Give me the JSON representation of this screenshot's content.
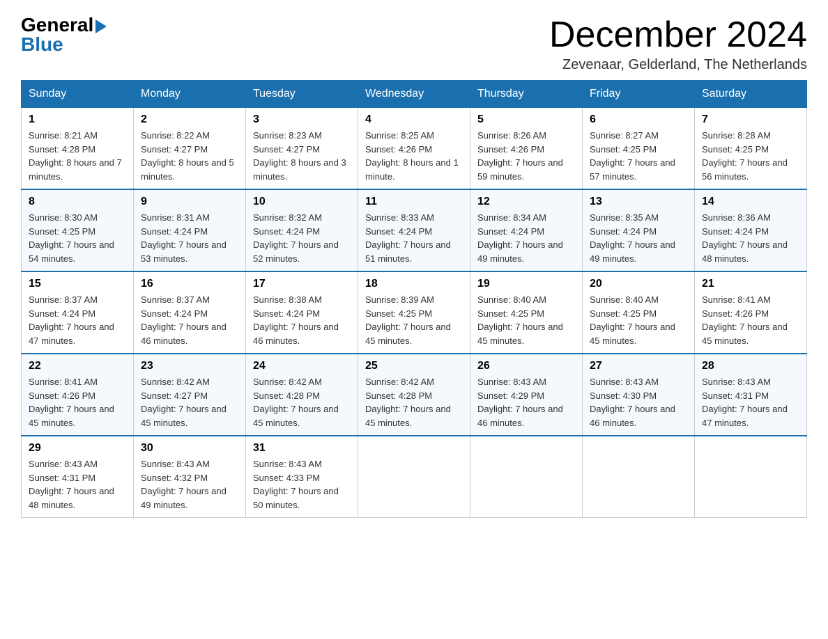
{
  "logo": {
    "general": "General",
    "blue": "Blue",
    "triangle": "▶"
  },
  "title": "December 2024",
  "location": "Zevenaar, Gelderland, The Netherlands",
  "days_of_week": [
    "Sunday",
    "Monday",
    "Tuesday",
    "Wednesday",
    "Thursday",
    "Friday",
    "Saturday"
  ],
  "weeks": [
    [
      {
        "day": "1",
        "sunrise": "8:21 AM",
        "sunset": "4:28 PM",
        "daylight": "8 hours and 7 minutes."
      },
      {
        "day": "2",
        "sunrise": "8:22 AM",
        "sunset": "4:27 PM",
        "daylight": "8 hours and 5 minutes."
      },
      {
        "day": "3",
        "sunrise": "8:23 AM",
        "sunset": "4:27 PM",
        "daylight": "8 hours and 3 minutes."
      },
      {
        "day": "4",
        "sunrise": "8:25 AM",
        "sunset": "4:26 PM",
        "daylight": "8 hours and 1 minute."
      },
      {
        "day": "5",
        "sunrise": "8:26 AM",
        "sunset": "4:26 PM",
        "daylight": "7 hours and 59 minutes."
      },
      {
        "day": "6",
        "sunrise": "8:27 AM",
        "sunset": "4:25 PM",
        "daylight": "7 hours and 57 minutes."
      },
      {
        "day": "7",
        "sunrise": "8:28 AM",
        "sunset": "4:25 PM",
        "daylight": "7 hours and 56 minutes."
      }
    ],
    [
      {
        "day": "8",
        "sunrise": "8:30 AM",
        "sunset": "4:25 PM",
        "daylight": "7 hours and 54 minutes."
      },
      {
        "day": "9",
        "sunrise": "8:31 AM",
        "sunset": "4:24 PM",
        "daylight": "7 hours and 53 minutes."
      },
      {
        "day": "10",
        "sunrise": "8:32 AM",
        "sunset": "4:24 PM",
        "daylight": "7 hours and 52 minutes."
      },
      {
        "day": "11",
        "sunrise": "8:33 AM",
        "sunset": "4:24 PM",
        "daylight": "7 hours and 51 minutes."
      },
      {
        "day": "12",
        "sunrise": "8:34 AM",
        "sunset": "4:24 PM",
        "daylight": "7 hours and 49 minutes."
      },
      {
        "day": "13",
        "sunrise": "8:35 AM",
        "sunset": "4:24 PM",
        "daylight": "7 hours and 49 minutes."
      },
      {
        "day": "14",
        "sunrise": "8:36 AM",
        "sunset": "4:24 PM",
        "daylight": "7 hours and 48 minutes."
      }
    ],
    [
      {
        "day": "15",
        "sunrise": "8:37 AM",
        "sunset": "4:24 PM",
        "daylight": "7 hours and 47 minutes."
      },
      {
        "day": "16",
        "sunrise": "8:37 AM",
        "sunset": "4:24 PM",
        "daylight": "7 hours and 46 minutes."
      },
      {
        "day": "17",
        "sunrise": "8:38 AM",
        "sunset": "4:24 PM",
        "daylight": "7 hours and 46 minutes."
      },
      {
        "day": "18",
        "sunrise": "8:39 AM",
        "sunset": "4:25 PM",
        "daylight": "7 hours and 45 minutes."
      },
      {
        "day": "19",
        "sunrise": "8:40 AM",
        "sunset": "4:25 PM",
        "daylight": "7 hours and 45 minutes."
      },
      {
        "day": "20",
        "sunrise": "8:40 AM",
        "sunset": "4:25 PM",
        "daylight": "7 hours and 45 minutes."
      },
      {
        "day": "21",
        "sunrise": "8:41 AM",
        "sunset": "4:26 PM",
        "daylight": "7 hours and 45 minutes."
      }
    ],
    [
      {
        "day": "22",
        "sunrise": "8:41 AM",
        "sunset": "4:26 PM",
        "daylight": "7 hours and 45 minutes."
      },
      {
        "day": "23",
        "sunrise": "8:42 AM",
        "sunset": "4:27 PM",
        "daylight": "7 hours and 45 minutes."
      },
      {
        "day": "24",
        "sunrise": "8:42 AM",
        "sunset": "4:28 PM",
        "daylight": "7 hours and 45 minutes."
      },
      {
        "day": "25",
        "sunrise": "8:42 AM",
        "sunset": "4:28 PM",
        "daylight": "7 hours and 45 minutes."
      },
      {
        "day": "26",
        "sunrise": "8:43 AM",
        "sunset": "4:29 PM",
        "daylight": "7 hours and 46 minutes."
      },
      {
        "day": "27",
        "sunrise": "8:43 AM",
        "sunset": "4:30 PM",
        "daylight": "7 hours and 46 minutes."
      },
      {
        "day": "28",
        "sunrise": "8:43 AM",
        "sunset": "4:31 PM",
        "daylight": "7 hours and 47 minutes."
      }
    ],
    [
      {
        "day": "29",
        "sunrise": "8:43 AM",
        "sunset": "4:31 PM",
        "daylight": "7 hours and 48 minutes."
      },
      {
        "day": "30",
        "sunrise": "8:43 AM",
        "sunset": "4:32 PM",
        "daylight": "7 hours and 49 minutes."
      },
      {
        "day": "31",
        "sunrise": "8:43 AM",
        "sunset": "4:33 PM",
        "daylight": "7 hours and 50 minutes."
      },
      null,
      null,
      null,
      null
    ]
  ]
}
